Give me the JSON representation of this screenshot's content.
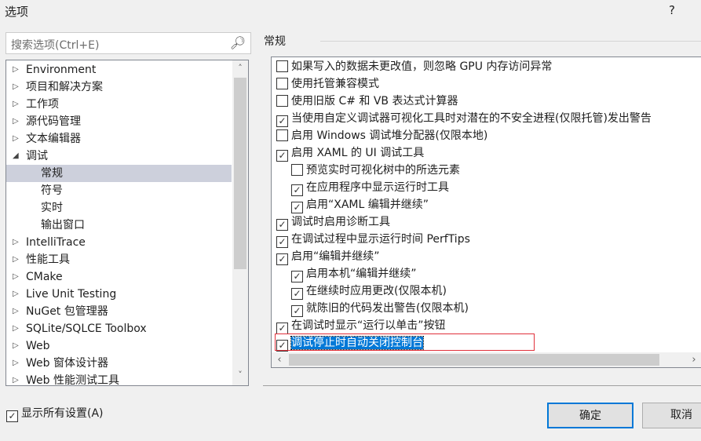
{
  "window": {
    "title": "选项",
    "help": "?"
  },
  "search": {
    "placeholder": "搜索选项(Ctrl+E)"
  },
  "tree": {
    "items": [
      {
        "label": "Environment",
        "level": 0,
        "expanded": false
      },
      {
        "label": "项目和解决方案",
        "level": 0,
        "expanded": false
      },
      {
        "label": "工作项",
        "level": 0,
        "expanded": false
      },
      {
        "label": "源代码管理",
        "level": 0,
        "expanded": false
      },
      {
        "label": "文本编辑器",
        "level": 0,
        "expanded": false
      },
      {
        "label": "调试",
        "level": 0,
        "expanded": true
      },
      {
        "label": "常规",
        "level": 1,
        "selected": true
      },
      {
        "label": "符号",
        "level": 1
      },
      {
        "label": "实时",
        "level": 1
      },
      {
        "label": "输出窗口",
        "level": 1
      },
      {
        "label": "IntelliTrace",
        "level": 0,
        "expanded": false
      },
      {
        "label": "性能工具",
        "level": 0,
        "expanded": false
      },
      {
        "label": "CMake",
        "level": 0,
        "expanded": false
      },
      {
        "label": "Live Unit Testing",
        "level": 0,
        "expanded": false
      },
      {
        "label": "NuGet 包管理器",
        "level": 0,
        "expanded": false
      },
      {
        "label": "SQLite/SQLCE Toolbox",
        "level": 0,
        "expanded": false
      },
      {
        "label": "Web",
        "level": 0,
        "expanded": false
      },
      {
        "label": "Web 窗体设计器",
        "level": 0,
        "expanded": false
      },
      {
        "label": "Web 性能测试工具",
        "level": 0,
        "expanded": false
      }
    ]
  },
  "section": {
    "title": "常规"
  },
  "options": [
    {
      "label": "如果写入的数据未更改值，则忽略 GPU 内存访问异常",
      "checked": false,
      "indent": 0
    },
    {
      "label": "使用托管兼容模式",
      "checked": false,
      "indent": 0
    },
    {
      "label": "使用旧版 C# 和 VB 表达式计算器",
      "checked": false,
      "indent": 0
    },
    {
      "label": "当使用自定义调试器可视化工具时对潜在的不安全进程(仅限托管)发出警告",
      "checked": true,
      "indent": 0
    },
    {
      "label": "启用 Windows 调试堆分配器(仅限本地)",
      "checked": false,
      "indent": 0
    },
    {
      "label": "启用 XAML 的 UI 调试工具",
      "checked": true,
      "indent": 0
    },
    {
      "label": "预览实时可视化树中的所选元素",
      "checked": false,
      "indent": 1
    },
    {
      "label": "在应用程序中显示运行时工具",
      "checked": true,
      "indent": 1
    },
    {
      "label": "启用“XAML 编辑并继续”",
      "checked": true,
      "indent": 1
    },
    {
      "label": "调试时启用诊断工具",
      "checked": true,
      "indent": 0
    },
    {
      "label": "在调试过程中显示运行时间 PerfTips",
      "checked": true,
      "indent": 0
    },
    {
      "label": "启用“编辑并继续”",
      "checked": true,
      "indent": 0
    },
    {
      "label": "启用本机“编辑并继续”",
      "checked": true,
      "indent": 1
    },
    {
      "label": "在继续时应用更改(仅限本机)",
      "checked": true,
      "indent": 1
    },
    {
      "label": "就陈旧的代码发出警告(仅限本机)",
      "checked": true,
      "indent": 1
    },
    {
      "label": "在调试时显示“运行以单击”按钮",
      "checked": true,
      "indent": 0
    },
    {
      "label": "调试停止时自动关闭控制台",
      "checked": true,
      "indent": 0,
      "selected": true
    }
  ],
  "footer": {
    "show_all_label": "显示所有设置(A)",
    "show_all_checked": true,
    "ok": "确定",
    "cancel": "取消"
  }
}
